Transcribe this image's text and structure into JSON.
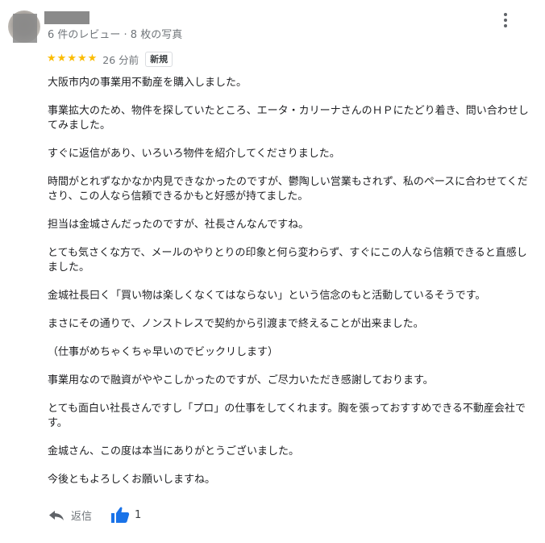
{
  "reviewer": {
    "meta": "6 件のレビュー · 8 枚の写真"
  },
  "rating": {
    "stars": 5,
    "time": "26 分前",
    "badge": "新規"
  },
  "review": {
    "paragraphs": [
      "大阪市内の事業用不動産を購入しました。",
      "事業拡大のため、物件を探していたところ、エータ・カリーナさんのＨＰにたどり着き、問い合わせしてみました。",
      "すぐに返信があり、いろいろ物件を紹介してくださりました。",
      "時間がとれずなかなか内見できなかったのですが、鬱陶しい営業もされず、私のペースに合わせてくださり、この人なら信頼できるかもと好感が持てました。",
      "担当は金城さんだったのですが、社長さんなんですね。",
      "とても気さくな方で、メールのやりとりの印象と何ら変わらず、すぐにこの人なら信頼できると直感しました。",
      "金城社長曰く「買い物は楽しくなくてはならない」という信念のもと活動しているそうです。",
      "まさにその通りで、ノンストレスで契約から引渡まで終えることが出来ました。",
      "（仕事がめちゃくちゃ早いのでビックリします）",
      "事業用なので融資がややこしかったのですが、ご尽力いただき感謝しております。",
      "とても面白い社長さんですし「プロ」の仕事をしてくれます。胸を張っておすすめできる不動産会社です。",
      "金城さん、この度は本当にありがとうございました。",
      "今後ともよろしくお願いしますね。"
    ]
  },
  "actions": {
    "reply_label": "返信",
    "like_count": "1"
  },
  "colors": {
    "star": "#fbbc04",
    "like": "#1a73e8",
    "secondary_text": "#70757a"
  }
}
